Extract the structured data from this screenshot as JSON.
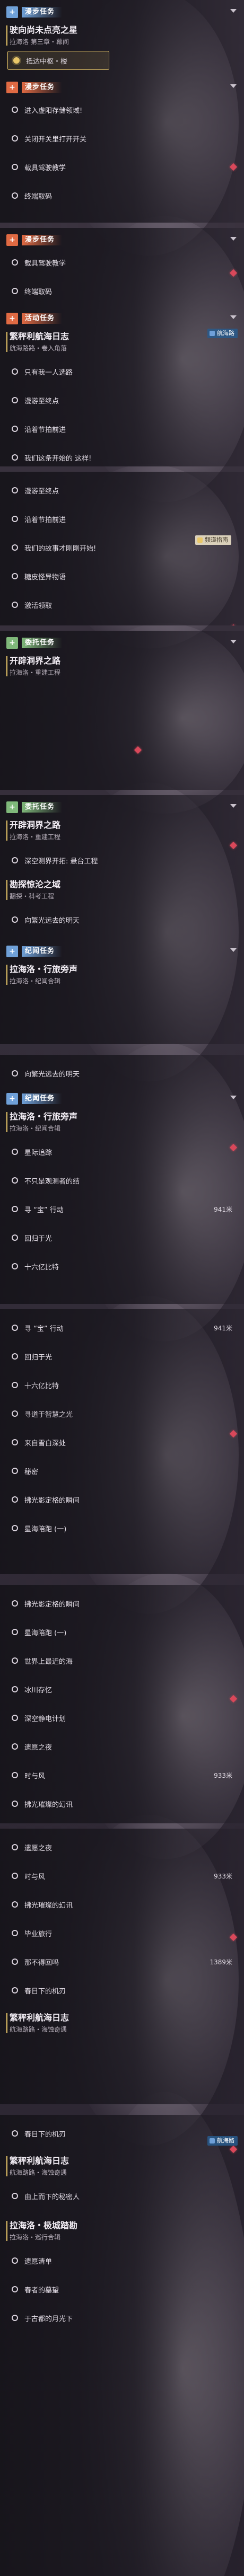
{
  "labels": {
    "plus": "+",
    "active": "活动任务",
    "side": "委托任务",
    "main": "开拓任务",
    "memory": "纪闻任务",
    "story": "冒险任务"
  },
  "colors": {
    "main": "#d98b4b",
    "active": "#e06a43",
    "side": "#7fb87a",
    "memory": "#6fa0d8",
    "gold": "#e9c769",
    "marker": "#d9485a"
  },
  "tags": {
    "voyage": "航海路",
    "note": "频道指南"
  },
  "panels": [
    {
      "sections": [
        {
          "type": "memory",
          "label": "漫步任务",
          "quests": [
            {
              "title": "驶向尚未点亮之星",
              "sub": "拉海洛 第三章・幕间",
              "objectives": [
                {
                  "text": "抵达中枢・楼",
                  "current": true
                }
              ]
            }
          ]
        },
        {
          "type": "active",
          "label": "漫步任务",
          "objectives": [
            {
              "text": "进入虚阳存储领域!"
            },
            {
              "text": "关闭开关里打开开关"
            },
            {
              "text": "载具驾驶教学"
            },
            {
              "text": "终端取码"
            }
          ]
        }
      ]
    },
    {
      "sections": [
        {
          "type": "active",
          "label": "漫步任务",
          "objectives": [
            {
              "text": "载具驾驶教学"
            },
            {
              "text": "终端取码"
            }
          ]
        },
        {
          "type": "active",
          "label": "活动任务",
          "quests": [
            {
              "title": "繁秤利航海日志",
              "sub": "航海路路・卷入角落",
              "objectives": [
                {
                  "text": "只有我一人选路"
                },
                {
                  "text": "漫游至终点"
                },
                {
                  "text": "沿着节拍前进"
                },
                {
                  "text": "我们这条开始的 这样!"
                }
              ]
            }
          ]
        }
      ]
    },
    {
      "sections": [
        {
          "type": "none",
          "objectives": [
            {
              "text": "漫游至终点"
            },
            {
              "text": "沿着节拍前进"
            },
            {
              "text": "我们的故事才刚刚开始!"
            },
            {
              "text": "糖皮怪异物语"
            },
            {
              "text": "激活领取"
            }
          ]
        }
      ]
    },
    {
      "sections": [
        {
          "type": "side",
          "label": "委托任务",
          "quests": [
            {
              "title": "开辟洞界之路",
              "sub": "拉海洛・重建工程",
              "objectives": []
            }
          ]
        }
      ]
    },
    {
      "sections": [
        {
          "type": "side",
          "label": "委托任务",
          "quests": [
            {
              "title": "开辟洞界之路",
              "sub": "拉海洛・重建工程",
              "objectives": [
                {
                  "text": "深空测界开拓: 悬台工程"
                }
              ]
            },
            {
              "title": "勘探惊沦之域",
              "sub": "翻探・科考工程",
              "objectives": [
                {
                  "text": "向繁光远去的明天"
                }
              ]
            }
          ]
        },
        {
          "type": "memory",
          "label": "纪闻任务",
          "quests": [
            {
              "title": "拉海洛・行旅旁声",
              "sub": "拉海洛・纪闻合辑",
              "objectives": []
            }
          ]
        }
      ]
    },
    {
      "sections": [
        {
          "type": "none",
          "objectives": [
            {
              "text": "向繁光远去的明天"
            }
          ]
        },
        {
          "type": "memory",
          "label": "纪闻任务",
          "quests": [
            {
              "title": "拉海洛・行旅旁声",
              "sub": "拉海洛・纪闻合辑",
              "objectives": [
                {
                  "text": "星际追踪"
                },
                {
                  "text": "不只是观测者的结"
                },
                {
                  "text": "寻 “宝” 行动",
                  "dist": "941米"
                },
                {
                  "text": "回归于光"
                },
                {
                  "text": "十六亿比特"
                }
              ]
            }
          ]
        }
      ]
    },
    {
      "sections": [
        {
          "type": "none",
          "objectives": [
            {
              "text": "寻 “宝” 行动",
              "dist": "941米"
            },
            {
              "text": "回归于光"
            },
            {
              "text": "十六亿比特"
            },
            {
              "text": "寻道于智慧之光"
            },
            {
              "text": "来自雪白深处"
            },
            {
              "text": "秘密"
            },
            {
              "text": "拂光影定格的瞬间"
            },
            {
              "text": "星海陪跑 (一)"
            }
          ]
        }
      ]
    },
    {
      "sections": [
        {
          "type": "none",
          "objectives": [
            {
              "text": "拂光影定格的瞬间"
            },
            {
              "text": "星海陪跑 (一)"
            },
            {
              "text": "世界上最近的海"
            },
            {
              "text": "冰川存忆"
            },
            {
              "text": "深空静电计划"
            },
            {
              "text": "遗愿之夜"
            },
            {
              "text": "时与风",
              "dist": "933米"
            },
            {
              "text": "拂光璀璨的幻讯"
            }
          ]
        }
      ]
    },
    {
      "sections": [
        {
          "type": "none",
          "objectives": [
            {
              "text": "遗愿之夜"
            },
            {
              "text": "时与风",
              "dist": "933米"
            },
            {
              "text": "拂光璀璨的幻讯"
            },
            {
              "text": "毕业旅行"
            },
            {
              "text": "那不得回吗",
              "dist": "1389米"
            },
            {
              "text": "春日下的机刃"
            }
          ]
        },
        {
          "type": "none",
          "quests": [
            {
              "title": "繁秤利航海日志",
              "sub": "航海路路・海蚀奇遇",
              "objectives": []
            }
          ]
        }
      ]
    },
    {
      "sections": [
        {
          "type": "none",
          "objectives": [
            {
              "text": "春日下的机刃"
            }
          ]
        },
        {
          "type": "none",
          "quests": [
            {
              "title": "繁秤利航海日志",
              "sub": "航海路路・海蚀奇遇",
              "objectives": [
                {
                  "text": "由上而下的秘密人"
                }
              ]
            }
          ]
        },
        {
          "type": "none",
          "quests": [
            {
              "title": "拉海洛・极城踏勘",
              "sub": "拉海洛・巡行合辑",
              "objectives": [
                {
                  "text": "遗愿清单"
                },
                {
                  "text": "春者的墓望"
                },
                {
                  "text": "于古都的月光下"
                }
              ]
            }
          ]
        }
      ]
    }
  ]
}
